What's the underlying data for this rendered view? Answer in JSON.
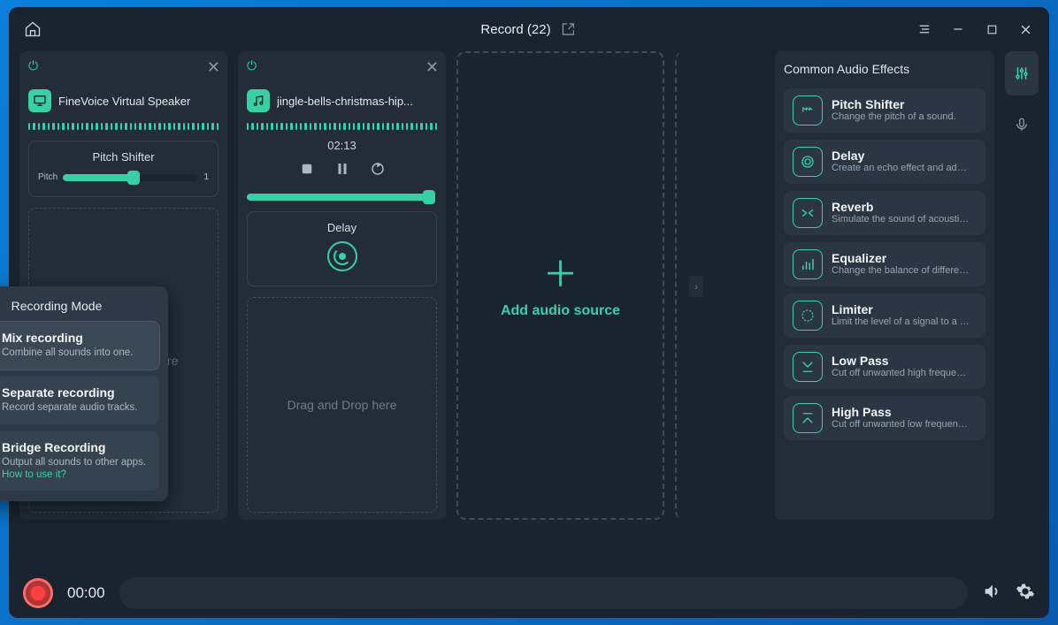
{
  "title": "Record (22)",
  "sources": [
    {
      "name": "FineVoice Virtual Speaker",
      "icon": "monitor"
    },
    {
      "name": "jingle-bells-christmas-hip...",
      "icon": "music"
    }
  ],
  "track1": {
    "effect": {
      "title": "Pitch Shifter",
      "param": "Pitch",
      "value": "1",
      "fill": 52
    }
  },
  "track2": {
    "time": "02:13",
    "progress": 96,
    "effect": {
      "title": "Delay"
    }
  },
  "drop_hint": "Drag and Drop here",
  "add_source_label": "Add audio source",
  "effects_title": "Common Audio Effects",
  "effects": [
    {
      "name": "Pitch Shifter",
      "desc": "Change the pitch of a sound.",
      "icon": "pitch"
    },
    {
      "name": "Delay",
      "desc": "Create an echo effect and add depth to vocals.",
      "icon": "delay"
    },
    {
      "name": "Reverb",
      "desc": "Simulate the sound of acoustic environments like v...",
      "icon": "reverb"
    },
    {
      "name": "Equalizer",
      "desc": "Change the balance of different frequencies to impr...",
      "icon": "eq"
    },
    {
      "name": "Limiter",
      "desc": "Limit the level of a signal to a certain threshold.",
      "icon": "limiter"
    },
    {
      "name": "Low Pass",
      "desc": "Cut off unwanted high frequencies.",
      "icon": "lowpass"
    },
    {
      "name": "High Pass",
      "desc": "Cut off unwanted low frequencies.",
      "icon": "highpass"
    }
  ],
  "rec_time": "00:00",
  "recording_mode": {
    "heading": "Recording Mode",
    "modes": [
      {
        "title": "Mix recording",
        "desc": "Combine all sounds into one.",
        "icon": "mix",
        "selected": true
      },
      {
        "title": "Separate recording",
        "desc": "Record separate audio tracks.",
        "icon": "layers",
        "selected": false
      },
      {
        "title": "Bridge Recording",
        "desc": "Output all sounds to other apps. ",
        "link": "How to use it?",
        "icon": "bridge",
        "selected": false
      }
    ]
  }
}
